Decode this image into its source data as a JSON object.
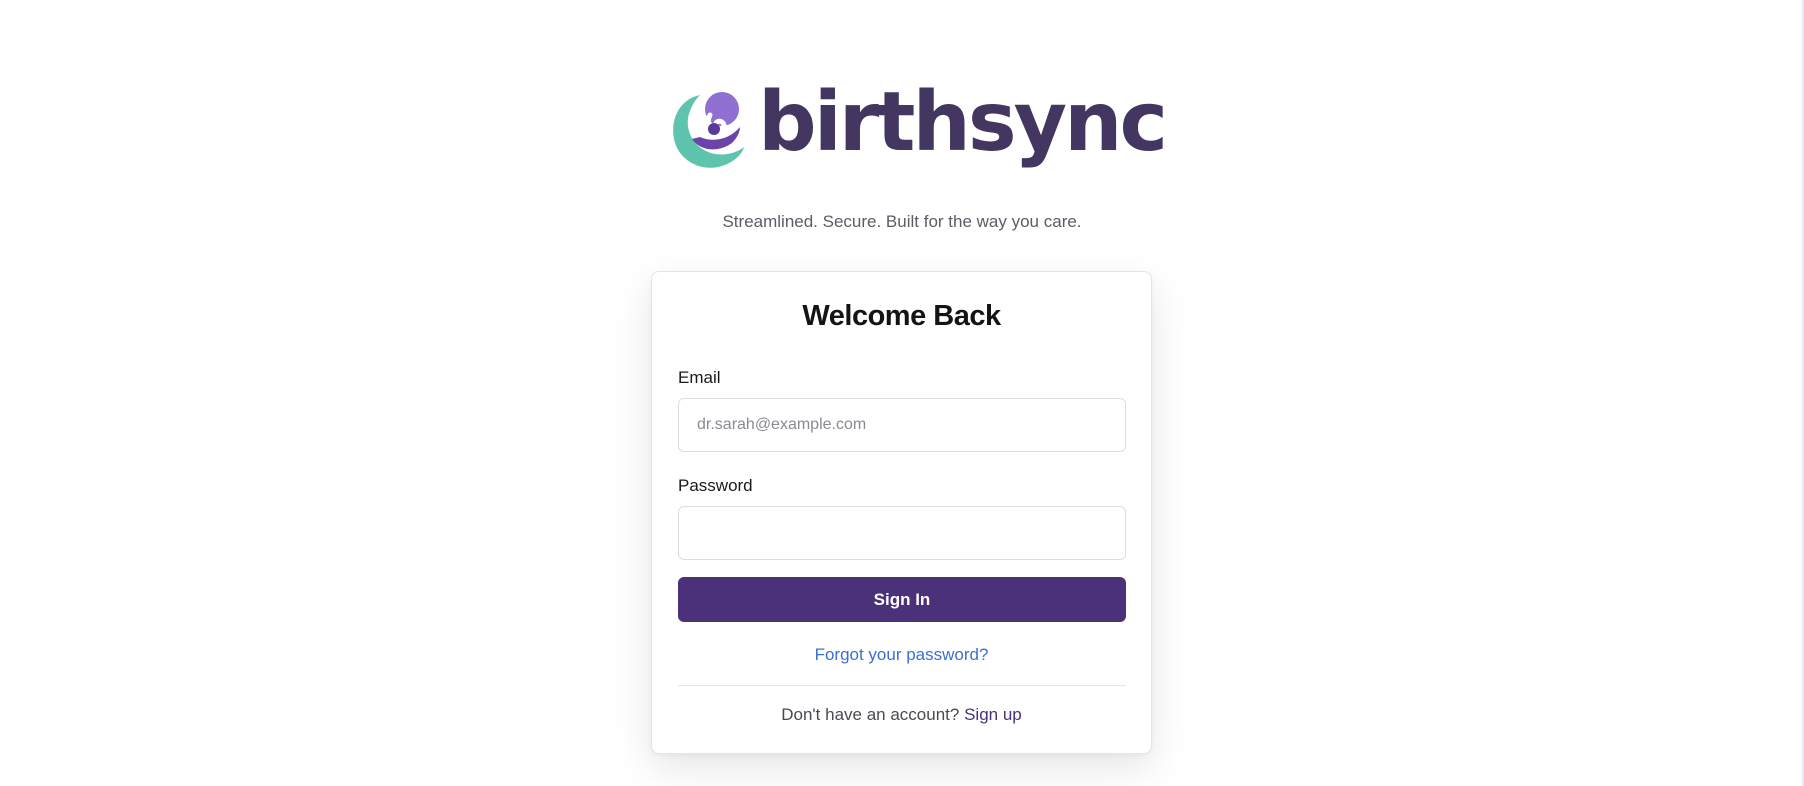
{
  "brand": {
    "name": "birthsync",
    "tagline": "Streamlined. Secure. Built for the way you care.",
    "colors": {
      "primary": "#4b307a",
      "wordmark": "#433660",
      "teal": "#5ec4ad",
      "purple": "#7a55b8",
      "link": "#3d6fd1"
    },
    "logo_icon": "mother-and-baby-icon"
  },
  "login": {
    "title": "Welcome Back",
    "email_label": "Email",
    "email_placeholder": "dr.sarah@example.com",
    "email_value": "",
    "password_label": "Password",
    "password_value": "",
    "signin_label": "Sign In",
    "forgot_label": "Forgot your password?",
    "signup_prompt": "Don't have an account?",
    "signup_label": "Sign up"
  }
}
